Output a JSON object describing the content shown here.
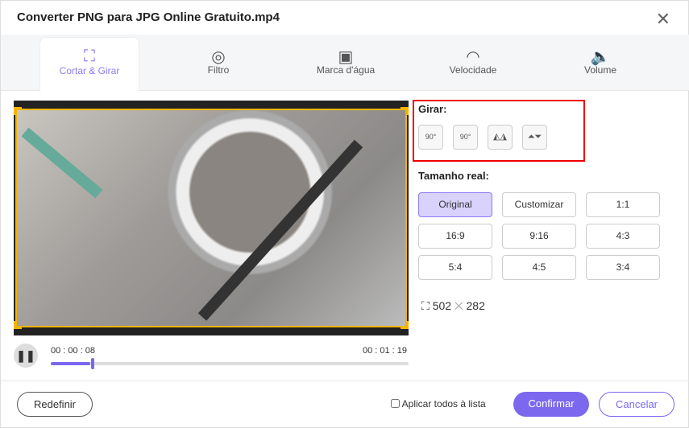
{
  "window": {
    "title": "Converter PNG para JPG Online Gratuito.mp4",
    "close": "✕"
  },
  "tabs": [
    {
      "label": "Cortar & Girar",
      "icon": "crop-icon"
    },
    {
      "label": "Filtro",
      "icon": "filter-icon"
    },
    {
      "label": "Marca d'água",
      "icon": "watermark-icon"
    },
    {
      "label": "Velocidade",
      "icon": "speed-icon"
    },
    {
      "label": "Volume",
      "icon": "volume-icon"
    }
  ],
  "player": {
    "current_time": "00 : 00 : 08",
    "total_time": "00 : 01 : 19",
    "progress": 0.11
  },
  "rotate": {
    "label": "Girar:",
    "buttons": [
      {
        "name": "rotate-left",
        "text": "90°"
      },
      {
        "name": "rotate-right",
        "text": "90°"
      },
      {
        "name": "flip-horizontal",
        "text": "◭◮"
      },
      {
        "name": "flip-vertical",
        "text": "⏶⏷"
      }
    ]
  },
  "size": {
    "label": "Tamanho real:",
    "options": [
      "Original",
      "Customizar",
      "1:1",
      "16:9",
      "9:16",
      "4:3",
      "5:4",
      "4:5",
      "3:4"
    ],
    "selected": "Original",
    "width": "502",
    "height": "282",
    "times": "✕"
  },
  "footer": {
    "reset": "Redefinir",
    "apply_all": "Aplicar todos à lista",
    "confirm": "Confirmar",
    "cancel": "Cancelar"
  },
  "colors": {
    "accent": "#7b68ee",
    "highlight": "#e00000"
  }
}
